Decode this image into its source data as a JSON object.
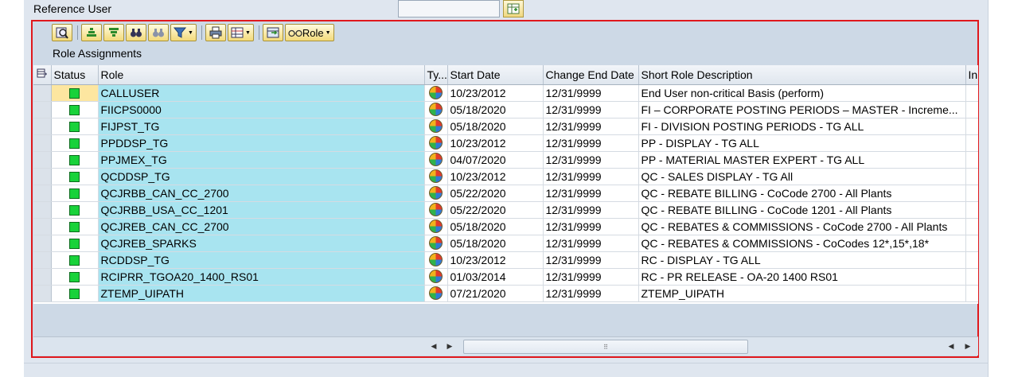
{
  "reference_user": {
    "label": "Reference User",
    "value": ""
  },
  "toolbar": {
    "role_button_label": "Role"
  },
  "panel_title": "Role Assignments",
  "columns": [
    "Status",
    "Role",
    "Ty...",
    "Start Date",
    "Change End Date",
    "Short Role Description",
    "In"
  ],
  "rows": [
    {
      "role": "CALLUSER",
      "start": "10/23/2012",
      "end": "12/31/9999",
      "desc": "End User non-critical Basis (perform)"
    },
    {
      "role": "FIICPS0000",
      "start": "05/18/2020",
      "end": "12/31/9999",
      "desc": "FI – CORPORATE POSTING PERIODS – MASTER - Increme..."
    },
    {
      "role": "FIJPST_TG",
      "start": "05/18/2020",
      "end": "12/31/9999",
      "desc": "FI - DIVISION POSTING PERIODS - TG ALL"
    },
    {
      "role": "PPDDSP_TG",
      "start": "10/23/2012",
      "end": "12/31/9999",
      "desc": "PP - DISPLAY - TG ALL"
    },
    {
      "role": "PPJMEX_TG",
      "start": "04/07/2020",
      "end": "12/31/9999",
      "desc": "PP - MATERIAL MASTER EXPERT - TG ALL"
    },
    {
      "role": "QCDDSP_TG",
      "start": "10/23/2012",
      "end": "12/31/9999",
      "desc": "QC - SALES DISPLAY - TG All"
    },
    {
      "role": "QCJRBB_CAN_CC_2700",
      "start": "05/22/2020",
      "end": "12/31/9999",
      "desc": "QC - REBATE BILLING - CoCode 2700 - All Plants"
    },
    {
      "role": "QCJRBB_USA_CC_1201",
      "start": "05/22/2020",
      "end": "12/31/9999",
      "desc": "QC - REBATE BILLING - CoCode 1201 - All Plants"
    },
    {
      "role": "QCJREB_CAN_CC_2700",
      "start": "05/18/2020",
      "end": "12/31/9999",
      "desc": "QC - REBATES & COMMISSIONS  -  CoCode 2700 - All Plants"
    },
    {
      "role": "QCJREB_SPARKS",
      "start": "05/18/2020",
      "end": "12/31/9999",
      "desc": "QC - REBATES & COMMISSIONS - CoCodes 12*,15*,18*"
    },
    {
      "role": "RCDDSP_TG",
      "start": "10/23/2012",
      "end": "12/31/9999",
      "desc": "RC - DISPLAY - TG ALL"
    },
    {
      "role": "RCIPRR_TGOA20_1400_RS01",
      "start": "01/03/2014",
      "end": "12/31/9999",
      "desc": "RC - PR RELEASE - OA-20 1400 RS01"
    },
    {
      "role": "ZTEMP_UIPATH",
      "start": "07/21/2020",
      "end": "12/31/9999",
      "desc": "ZTEMP_UIPATH"
    }
  ],
  "colors": {
    "status_green": "#18d23a",
    "role_highlight": "#a8e4f0",
    "frame_red": "#e0181c"
  },
  "icons": {
    "status": "green-square-icon",
    "type": "composite-role-pie-icon"
  }
}
